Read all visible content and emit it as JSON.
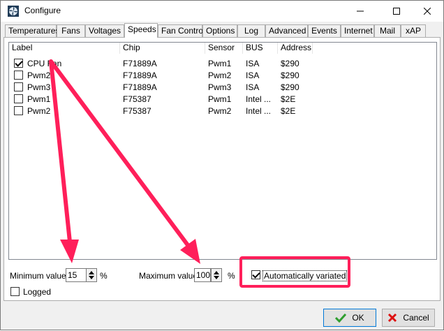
{
  "window": {
    "title": "Configure"
  },
  "tabs": [
    "Temperatures",
    "Fans",
    "Voltages",
    "Speeds",
    "Fan Control",
    "Options",
    "Log",
    "Advanced",
    "Events",
    "Internet",
    "Mail",
    "xAP"
  ],
  "active_tab": "Speeds",
  "table": {
    "columns": [
      "Label",
      "Chip",
      "Sensor",
      "BUS",
      "Address"
    ],
    "rows": [
      {
        "checked": true,
        "label": "CPU Fan",
        "chip": "F71889A",
        "sensor": "Pwm1",
        "bus": "ISA",
        "address": "$290"
      },
      {
        "checked": false,
        "label": "Pwm2",
        "chip": "F71889A",
        "sensor": "Pwm2",
        "bus": "ISA",
        "address": "$290"
      },
      {
        "checked": false,
        "label": "Pwm3",
        "chip": "F71889A",
        "sensor": "Pwm3",
        "bus": "ISA",
        "address": "$290"
      },
      {
        "checked": false,
        "label": "Pwm1",
        "chip": "F75387",
        "sensor": "Pwm1",
        "bus": "Intel ...",
        "address": "$2E"
      },
      {
        "checked": false,
        "label": "Pwm2",
        "chip": "F75387",
        "sensor": "Pwm2",
        "bus": "Intel ...",
        "address": "$2E"
      }
    ]
  },
  "controls": {
    "min_label": "Minimum value",
    "min_value": "15",
    "min_unit": "%",
    "max_label": "Maximum value",
    "max_value": "100",
    "max_unit": "%",
    "auto_label": "Automatically variated",
    "auto_checked": true,
    "logged_label": "Logged",
    "logged_checked": false
  },
  "buttons": {
    "ok": "OK",
    "cancel": "Cancel"
  },
  "colors": {
    "annotation": "#ff1f5a",
    "ok_icon": "#2f9e2f",
    "cancel_icon": "#d11"
  }
}
